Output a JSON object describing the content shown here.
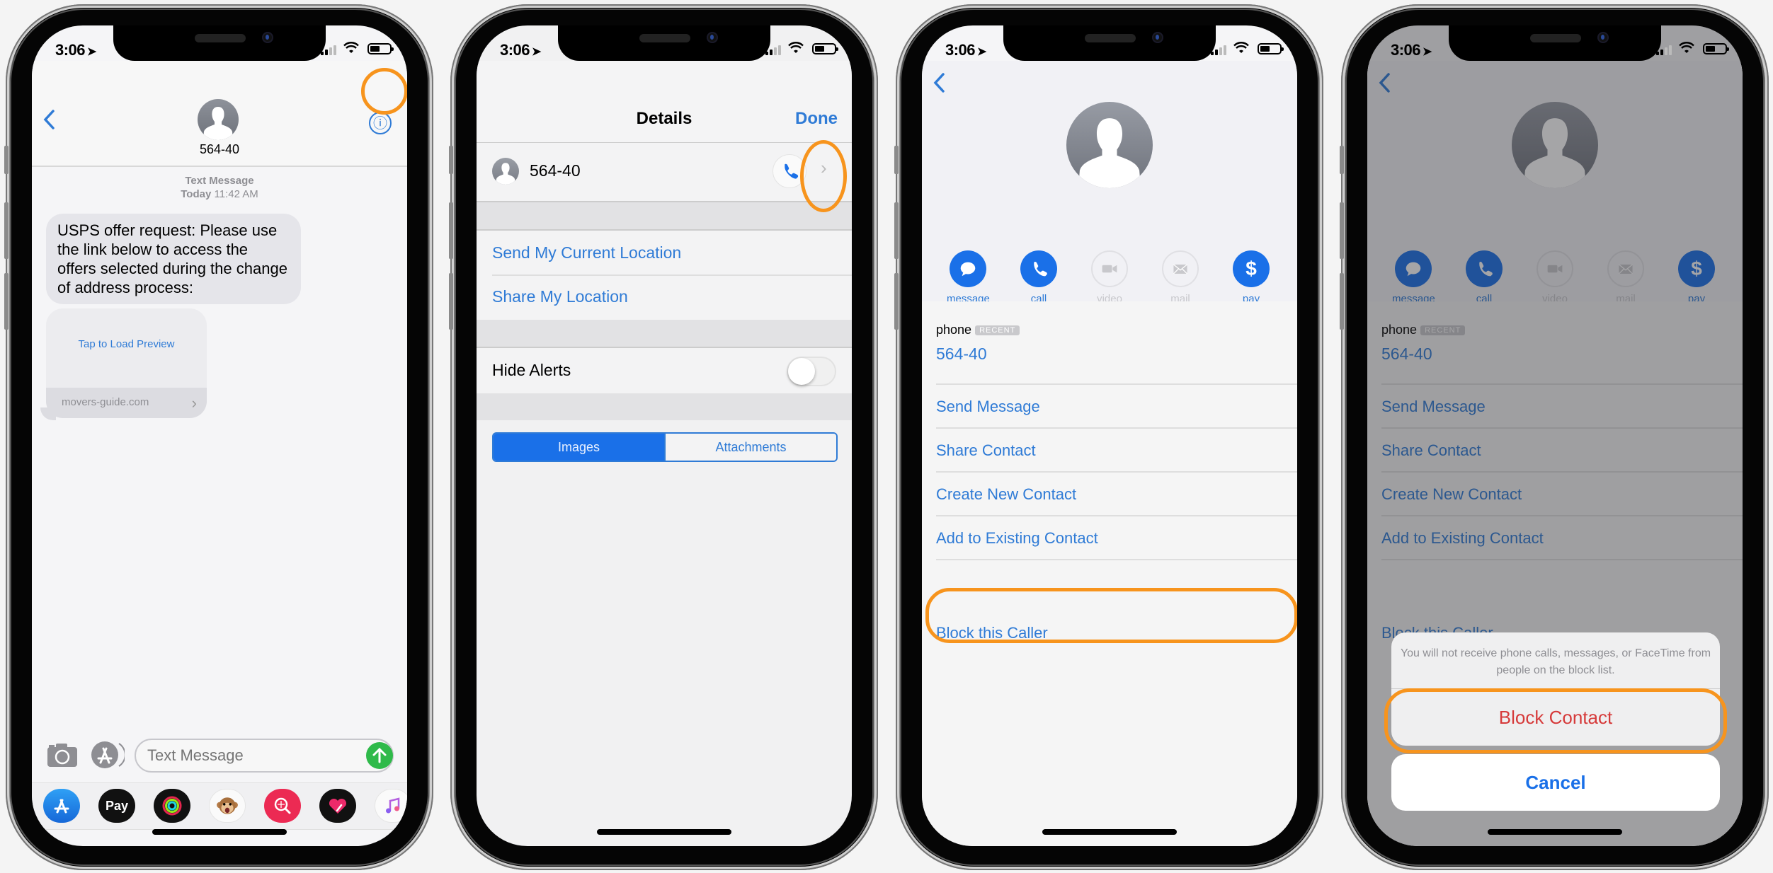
{
  "status_bar": {
    "time": "3:06",
    "location_arrow": "➤"
  },
  "highlight_color": "#f7941d",
  "accent_color": "#2f7bd6",
  "phone1": {
    "contact_name": "564-40",
    "info_icon": "ⓘ",
    "message_meta_type": "Text Message",
    "message_meta_day": "Today",
    "message_meta_time": "11:42 AM",
    "message_text": "USPS offer request: Please use the link below to access the offers selected during the change of address process:",
    "link_preview_action": "Tap to Load Preview",
    "link_domain": "movers-guide.com",
    "input_placeholder": "Text Message",
    "app_drawer": [
      {
        "name": "App Store",
        "icon": "appstore-icon"
      },
      {
        "name": "Apple Pay",
        "label": "Pay",
        "icon": "applepay-icon"
      },
      {
        "name": "Activity",
        "icon": "activity-icon"
      },
      {
        "name": "Animoji",
        "icon": "animoji-icon"
      },
      {
        "name": "Images Search",
        "icon": "image-search-icon"
      },
      {
        "name": "Digital Touch",
        "icon": "digital-touch-icon"
      },
      {
        "name": "Music",
        "icon": "music-icon"
      }
    ]
  },
  "phone2": {
    "title": "Details",
    "done_label": "Done",
    "contact_name": "564-40",
    "location_items": [
      "Send My Current Location",
      "Share My Location"
    ],
    "hide_alerts_label": "Hide Alerts",
    "hide_alerts_on": false,
    "segments": [
      "Images",
      "Attachments"
    ],
    "selected_segment": "Images"
  },
  "phone3": {
    "actions": [
      {
        "label": "message",
        "enabled": true
      },
      {
        "label": "call",
        "enabled": true
      },
      {
        "label": "video",
        "enabled": false
      },
      {
        "label": "mail",
        "enabled": false
      },
      {
        "label": "pay",
        "enabled": true
      }
    ],
    "phone_label": "phone",
    "recent_badge": "RECENT",
    "phone_number": "564-40",
    "list_items": [
      "Send Message",
      "Share Contact",
      "Create New Contact",
      "Add to Existing Contact"
    ],
    "block_label": "Block this Caller"
  },
  "phone4": {
    "sheet_message": "You will not receive phone calls, messages, or FaceTime from people on the block list.",
    "block_contact_label": "Block Contact",
    "cancel_label": "Cancel",
    "destructive_color": "#d63a3a"
  }
}
